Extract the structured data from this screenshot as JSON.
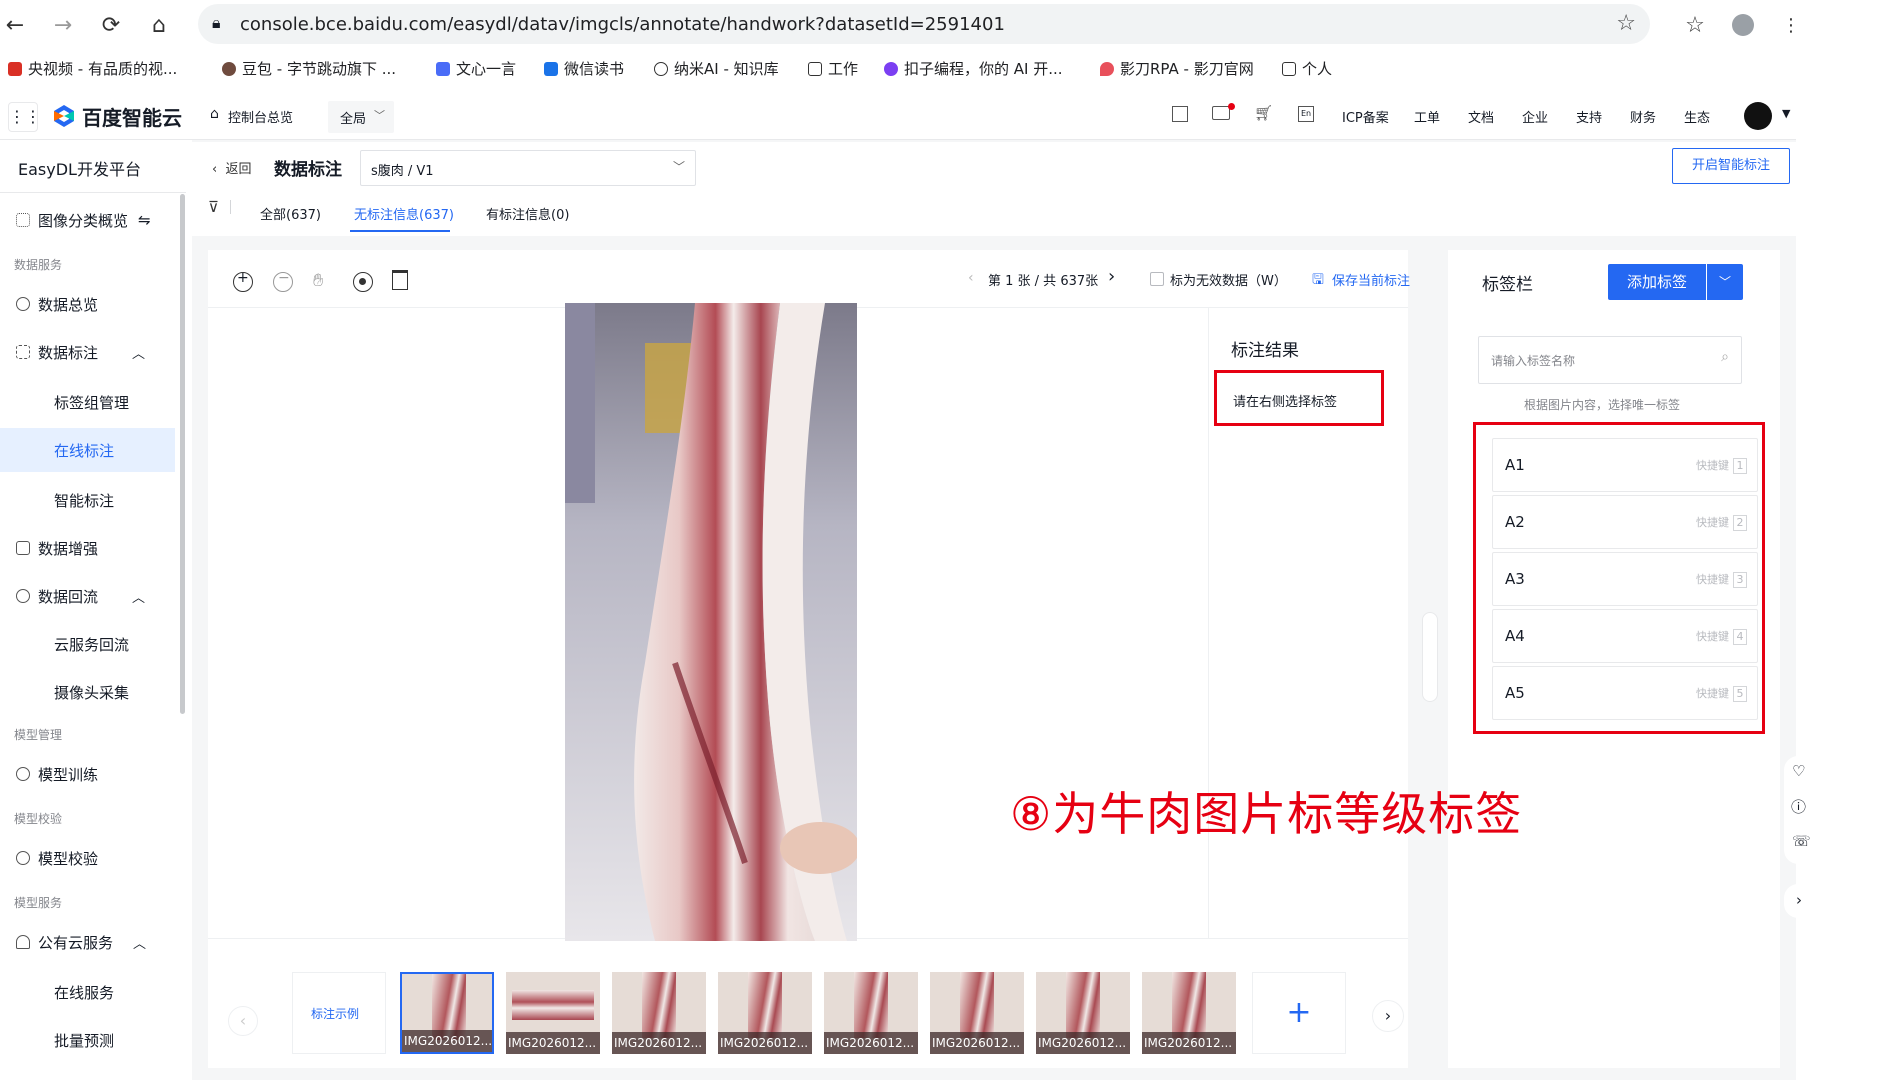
{
  "browser": {
    "url": "console.bce.baidu.com/easydl/datav/imgcls/annotate/handwork?datasetId=2591401",
    "bookmarks": [
      "央视频 - 有品质的视...",
      "豆包 - 字节跳动旗下 ...",
      "文心一言",
      "微信读书",
      "纳米AI - 知识库",
      "工作",
      "扣子编程，你的 AI 开...",
      "影刀RPA - 影刀官网",
      "个人"
    ]
  },
  "header": {
    "logo": "百度智能云",
    "console_home": "控制台总览",
    "region": "全局",
    "links": [
      "ICP备案",
      "工单",
      "文档",
      "企业",
      "支持",
      "财务",
      "生态"
    ]
  },
  "sidebar": {
    "title": "EasyDL开发平台",
    "overview": "图像分类概览",
    "sections": {
      "data": "数据服务",
      "model": "模型管理",
      "verify": "模型校验",
      "deploy": "模型服务"
    },
    "items": [
      "数据总览",
      "数据标注",
      "标签组管理",
      "在线标注",
      "智能标注",
      "数据增强",
      "数据回流",
      "云服务回流",
      "摄像头采集",
      "模型训练",
      "模型校验",
      "公有云服务",
      "在线服务",
      "批量预测"
    ]
  },
  "toolbar": {
    "back": "返回",
    "title": "数据标注",
    "dataset": "s腹肉 / V1",
    "smart_button": "开启智能标注"
  },
  "tabs": [
    "全部(637)",
    "无标注信息(637)",
    "有标注信息(0)"
  ],
  "viewer": {
    "pager": "第 1 张 / 共 637张",
    "invalid": "标为无效数据（W）",
    "save": "保存当前标注",
    "result_title": "标注结果",
    "result_hint": "请在右侧选择标签"
  },
  "labels_panel": {
    "title": "标签栏",
    "add": "添加标签",
    "search_placeholder": "请输入标签名称",
    "hint": "根据图片内容，选择唯一标签",
    "shortcut": "快捷键",
    "items": [
      {
        "name": "A1",
        "key": "1"
      },
      {
        "name": "A2",
        "key": "2"
      },
      {
        "name": "A3",
        "key": "3"
      },
      {
        "name": "A4",
        "key": "4"
      },
      {
        "name": "A5",
        "key": "5"
      }
    ]
  },
  "annotation": "⑧为牛肉图片标等级标签",
  "thumbs": {
    "example": "标注示例",
    "captions": [
      "IMG2026012...",
      "IMG2026012...",
      "IMG2026012...",
      "IMG2026012...",
      "IMG2026012...",
      "IMG2026012...",
      "IMG2026012...",
      "IMG2026012..."
    ]
  },
  "colors": {
    "accent": "#2468f2",
    "highlight": "#e60012",
    "active_bg": "#e6f0ff"
  }
}
